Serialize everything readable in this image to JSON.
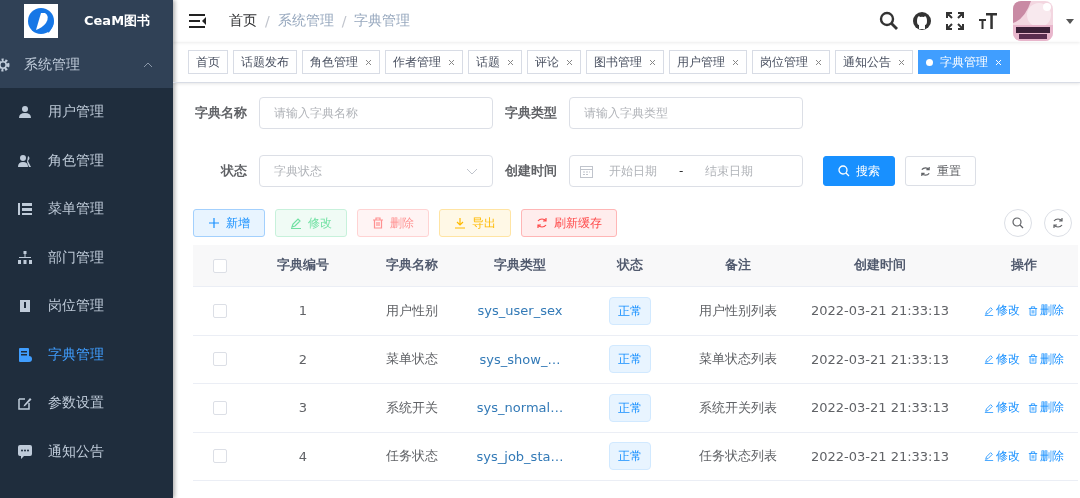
{
  "sidebar": {
    "logo_text": "CeaM图书",
    "menu": {
      "label": "系统管理",
      "expanded": true,
      "children": [
        {
          "label": "用户管理",
          "selected": false
        },
        {
          "label": "角色管理",
          "selected": false
        },
        {
          "label": "菜单管理",
          "selected": false
        },
        {
          "label": "部门管理",
          "selected": false
        },
        {
          "label": "岗位管理",
          "selected": false
        },
        {
          "label": "字典管理",
          "selected": true
        },
        {
          "label": "参数设置",
          "selected": false
        },
        {
          "label": "通知公告",
          "selected": false
        }
      ]
    }
  },
  "breadcrumb": [
    "首页",
    "系统管理",
    "字典管理"
  ],
  "breadcrumb_separator": "/",
  "tags": [
    {
      "label": "首页",
      "closable": false,
      "selected": false
    },
    {
      "label": "话题发布",
      "closable": false,
      "selected": false
    },
    {
      "label": "角色管理",
      "closable": true,
      "selected": false
    },
    {
      "label": "作者管理",
      "closable": true,
      "selected": false
    },
    {
      "label": "话题",
      "closable": true,
      "selected": false
    },
    {
      "label": "评论",
      "closable": true,
      "selected": false
    },
    {
      "label": "图书管理",
      "closable": true,
      "selected": false
    },
    {
      "label": "用户管理",
      "closable": true,
      "selected": false
    },
    {
      "label": "岗位管理",
      "closable": true,
      "selected": false
    },
    {
      "label": "通知公告",
      "closable": true,
      "selected": false
    },
    {
      "label": "字典管理",
      "closable": true,
      "selected": true
    }
  ],
  "filters": [
    {
      "kind": "text",
      "label": "字典名称",
      "placeholder": "请输入字典名称"
    },
    {
      "kind": "text",
      "label": "字典类型",
      "placeholder": "请输入字典类型"
    },
    {
      "kind": "select",
      "label": "状态",
      "placeholder": "字典状态"
    },
    {
      "kind": "daterange",
      "label": "创建时间",
      "start_placeholder": "开始日期",
      "separator": "-",
      "end_placeholder": "结束日期"
    }
  ],
  "search_button": "搜索",
  "reset_button": "重置",
  "toolbar": [
    {
      "kind": "add",
      "label": "新增",
      "disabled": false
    },
    {
      "kind": "edit",
      "label": "修改",
      "disabled": true
    },
    {
      "kind": "delete",
      "label": "删除",
      "disabled": true
    },
    {
      "kind": "export",
      "label": "导出",
      "disabled": false
    },
    {
      "kind": "refresh",
      "label": "刷新缓存",
      "disabled": false
    }
  ],
  "table": {
    "select_all_checked": false,
    "columns": [
      "字典编号",
      "字典名称",
      "字典类型",
      "状态",
      "备注",
      "创建时间",
      "操作"
    ],
    "rows": [
      {
        "checked": false,
        "id": "1",
        "name": "用户性别",
        "type": "sys_user_sex",
        "status": "正常",
        "remark": "用户性别列表",
        "created": "2022-03-21 21:33:13",
        "actions": [
          "修改",
          "删除"
        ]
      },
      {
        "checked": false,
        "id": "2",
        "name": "菜单状态",
        "type": "sys_show_…",
        "status": "正常",
        "remark": "菜单状态列表",
        "created": "2022-03-21 21:33:13",
        "actions": [
          "修改",
          "删除"
        ]
      },
      {
        "checked": false,
        "id": "3",
        "name": "系统开关",
        "type": "sys_normal…",
        "status": "正常",
        "remark": "系统开关列表",
        "created": "2022-03-21 21:33:13",
        "actions": [
          "修改",
          "删除"
        ]
      },
      {
        "checked": false,
        "id": "4",
        "name": "任务状态",
        "type": "sys_job_sta…",
        "status": "正常",
        "remark": "任务状态列表",
        "created": "2022-03-21 21:33:13",
        "actions": [
          "修改",
          "删除"
        ]
      }
    ]
  }
}
